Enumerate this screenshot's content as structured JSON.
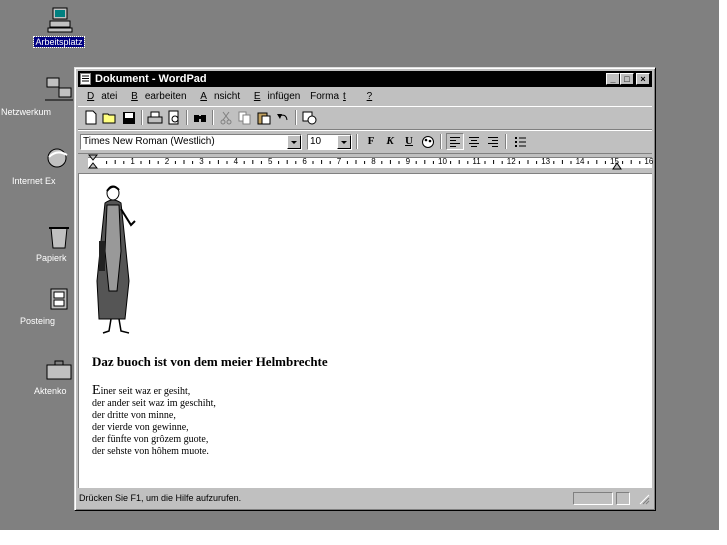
{
  "desktop": {
    "icons": [
      {
        "label": "Arbeitsplatz",
        "icon": "computer-icon"
      },
      {
        "label": "Netzwerkum",
        "icon": "network-icon"
      },
      {
        "label": "Internet Ex",
        "icon": "internet-explorer-icon"
      },
      {
        "label": "Papierk",
        "icon": "recycle-bin-icon"
      },
      {
        "label": "Posteing",
        "icon": "inbox-icon"
      },
      {
        "label": "Aktenko",
        "icon": "briefcase-icon"
      }
    ]
  },
  "window": {
    "title": "Dokument - WordPad",
    "menu": [
      {
        "label": "Datei",
        "underline": "D"
      },
      {
        "label": "Bearbeiten",
        "underline": "B"
      },
      {
        "label": "Ansicht",
        "underline": "A"
      },
      {
        "label": "Einfügen",
        "underline": "E"
      },
      {
        "label": "Format",
        "underline": "t"
      },
      {
        "label": "?",
        "underline": "?"
      }
    ],
    "toolbar": [
      "new-icon",
      "open-icon",
      "save-icon",
      "print-icon",
      "print-preview-icon",
      "find-icon",
      "cut-icon",
      "copy-icon",
      "paste-icon",
      "undo-icon",
      "insert-datetime-icon"
    ],
    "format_bar": {
      "font": "Times New Roman (Westlich)",
      "size": "10",
      "bold_label": "F",
      "italic_label": "K",
      "underline_label": "U"
    },
    "ruler": {
      "numbers": [
        "1",
        "2",
        "3",
        "4",
        "5",
        "6",
        "7",
        "8",
        "9",
        "10",
        "11",
        "12",
        "13",
        "14",
        "15",
        "16"
      ]
    },
    "document": {
      "heading": "Daz buoch ist von dem meier Helmbrechte",
      "first_letter": "E",
      "lines": [
        "iner seit waz er gesiht,",
        "der ander seit waz im geschiht,",
        "der dritte von minne,",
        "der vierde von gewinne,",
        "der fünfte von grôzem guote,",
        "der sehste von hôhem muote."
      ]
    },
    "status": "Drücken Sie F1, um die Hilfe aufzurufen."
  },
  "colors": {
    "desktop": "#808080",
    "face": "#c0c0c0",
    "titlebar": "#000000",
    "selection": "#000080"
  }
}
